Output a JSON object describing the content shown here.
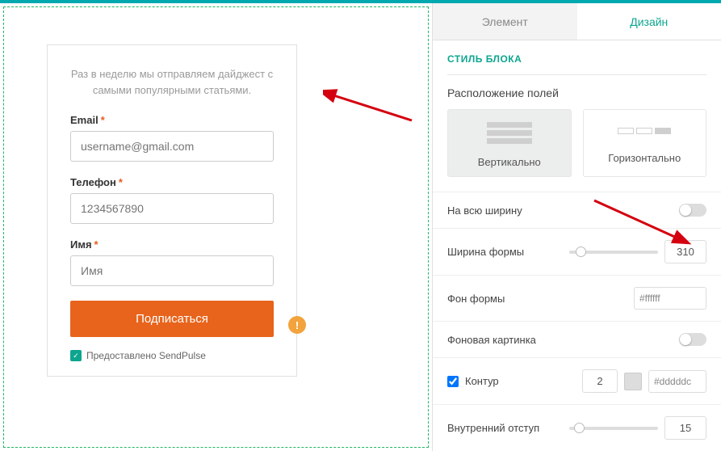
{
  "form": {
    "intro": "Раз в неделю мы отправляем дайджест с самыми популярными статьями.",
    "email_label": "Email",
    "email_placeholder": "username@gmail.com",
    "phone_label": "Телефон",
    "phone_placeholder": "1234567890",
    "name_label": "Имя",
    "name_placeholder": "Имя",
    "submit": "Подписаться",
    "attribution": "Предоставлено SendPulse"
  },
  "tabs": {
    "element": "Элемент",
    "design": "Дизайн"
  },
  "panel": {
    "section": "СТИЛЬ БЛОКА",
    "layout_title": "Расположение полей",
    "vertical": "Вертикально",
    "horizontal": "Горизонтально",
    "full_width": "На всю ширину",
    "form_width": "Ширина формы",
    "form_width_value": "310",
    "bg": "Фон формы",
    "bg_value": "#ffffff",
    "bg_image": "Фоновая картинка",
    "outline": "Контур",
    "outline_width": "2",
    "outline_color": "#dddddc",
    "padding": "Внутренний отступ",
    "padding_value": "15"
  }
}
